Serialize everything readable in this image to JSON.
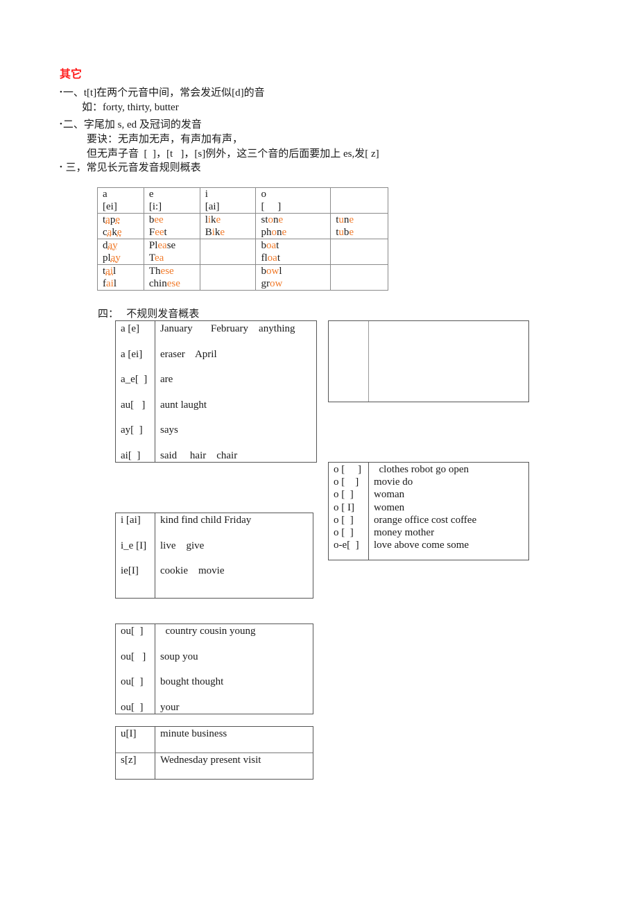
{
  "section_title": "其它",
  "items": [
    {
      "bullet": "•",
      "text": "一、t[t]在两个元音中间，常会发近似[d]的音"
    },
    {
      "text": "如：forty, thirty, butter"
    },
    {
      "bullet": "•",
      "text": "二、字尾加 s, ed 及冠词的发音"
    },
    {
      "text": "要诀：无声加无声，有声加有声，"
    },
    {
      "text": "但无声子音  [  ]，[t   ]，[s]例外，这三个音的后面要加上 es,发[ z]"
    },
    {
      "bullet": "•",
      "text": " 三，常见长元音发音规则概表"
    }
  ],
  "long_vowel_table": {
    "header": [
      {
        "letter": "a",
        "sound": "[ei]"
      },
      {
        "letter": "e",
        "sound": "[i:]"
      },
      {
        "letter": "i",
        "sound": "[ai]"
      },
      {
        "letter": "o",
        "sound": "[     ]"
      },
      {
        "letter": "",
        "sound": ""
      }
    ],
    "rows": [
      [
        "tape\ncake",
        "bee\nFeet",
        "like\nBike",
        "stone\nphone",
        "tune\ntube"
      ],
      [
        "day\nplay",
        "Please\nTea",
        "",
        "boat\nfloat",
        ""
      ],
      [
        "tail\nfail",
        "These\nchinese",
        "",
        "bowl\ngrow",
        ""
      ]
    ],
    "highlight_color": "#f07a2a"
  },
  "irregular_heading": "四：   不规则发音概表",
  "table_a": [
    {
      "sound": "a [e]",
      "words": "January       February    anything"
    },
    {
      "sound": "a [ei]",
      "words": "eraser    April"
    },
    {
      "sound": "a_e[  ]",
      "words": "are"
    },
    {
      "sound": "au[   ]",
      "words": "aunt laught"
    },
    {
      "sound": "ay[  ]",
      "words": "says"
    },
    {
      "sound": "ai[  ]",
      "words": "said     hair    chair"
    }
  ],
  "table_o": [
    {
      "sound": "o [     ]",
      "words": "  clothes robot go open"
    },
    {
      "sound": "o [    ]",
      "words": "movie do"
    },
    {
      "sound": "o [  ]",
      "words": "woman"
    },
    {
      "sound": "o [ I]",
      "words": "women"
    },
    {
      "sound": "o [  ]",
      "words": "orange office cost coffee"
    },
    {
      "sound": "o [  ]",
      "words": "money mother"
    },
    {
      "sound": "o-e[  ]",
      "words": "love above come some"
    }
  ],
  "table_i": [
    {
      "sound": "i [ai]",
      "words": "kind find child Friday"
    },
    {
      "sound": "i_e [I]",
      "words": "live    give"
    },
    {
      "sound": "ie[I]",
      "words": "cookie    movie"
    }
  ],
  "table_ou": [
    {
      "sound": "ou[  ]",
      "words": "  country cousin young"
    },
    {
      "sound": "ou[   ]",
      "words": "soup you"
    },
    {
      "sound": "ou[  ]",
      "words": "bought thought"
    },
    {
      "sound": "ou[  ]",
      "words": "your"
    }
  ],
  "table_us": [
    {
      "sound": "u[I]",
      "words": "minute business"
    },
    {
      "sound": "s[z]",
      "words": "Wednesday present visit"
    }
  ]
}
